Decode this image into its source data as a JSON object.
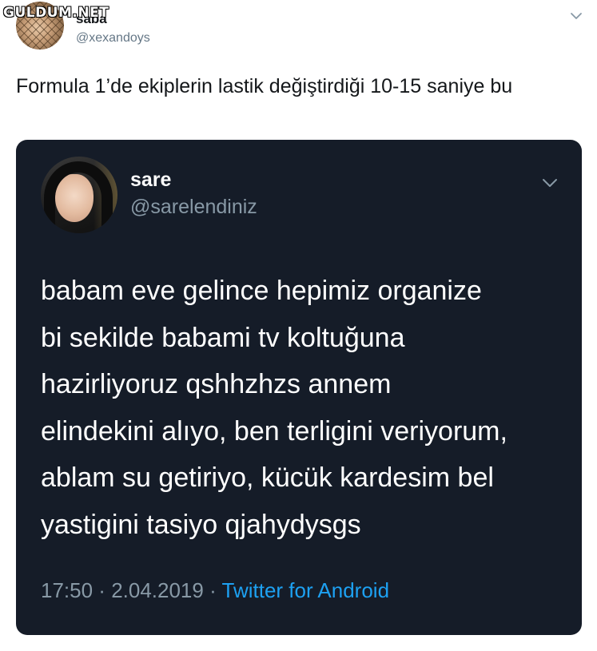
{
  "watermark": "GULDUM.NET",
  "outer_tweet": {
    "display_name": "saba",
    "handle": "@xexandoys",
    "text": "Formula 1’de ekiplerin lastik değiştirdiği 10-15 saniye bu",
    "caret_icon": "chevron-down-icon"
  },
  "quoted_tweet": {
    "display_name": "sare",
    "handle": "@sarelendiniz",
    "lines": [
      "babam eve gelince hepimiz organize",
      "bi sekilde babami tv koltuğuna",
      "hazirliyoruz qshhzhzs annem",
      "elindekini alıyo, ben terligini veriyorum,",
      "ablam su getiriyo, kücük kardesim bel",
      "yastigini tasiyo qjahydysgs"
    ],
    "time": "17:50",
    "date": "2.04.2019",
    "separator": " · ",
    "source": "Twitter for Android",
    "caret_icon": "chevron-down-icon"
  },
  "colors": {
    "card_background": "#151c28",
    "link": "#1da1f2",
    "muted": "#8899a6",
    "outer_muted": "#657786"
  }
}
